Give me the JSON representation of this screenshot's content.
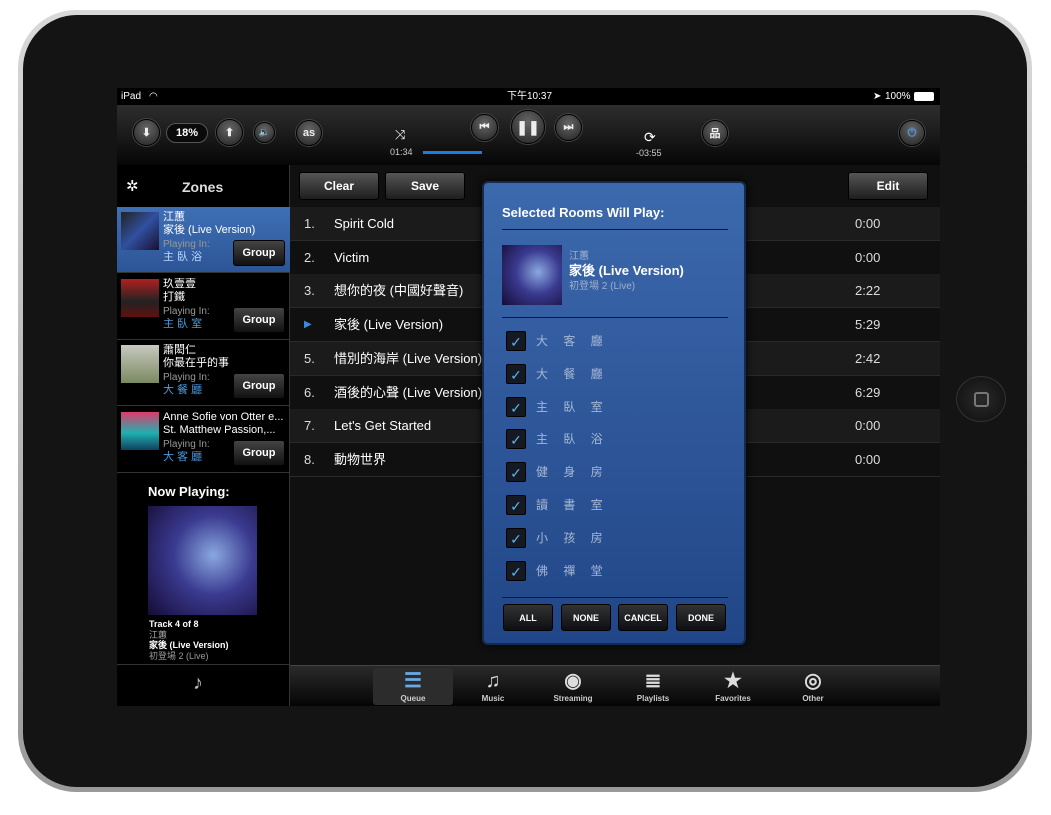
{
  "status_bar": {
    "device": "iPad",
    "time": "下午10:37",
    "battery": "100%"
  },
  "toolbar": {
    "volume": "18%",
    "elapsed": "01:34",
    "remaining": "-03:55",
    "progress_percent": 28,
    "lastfm_label": "as"
  },
  "sidebar": {
    "title": "Zones",
    "zones": [
      {
        "artist": "江蕙",
        "track": "家後 (Live Version)",
        "playing_in_label": "Playing In:",
        "room": "主 臥 浴",
        "group_label": "Group",
        "selected": true
      },
      {
        "artist": "玖壹壹",
        "track": "打鐵",
        "playing_in_label": "Playing In:",
        "room": "主 臥 室",
        "group_label": "Group"
      },
      {
        "artist": "蕭閎仁",
        "track": "你最在乎的事",
        "playing_in_label": "Playing In:",
        "room": "大 餐 廳",
        "group_label": "Group"
      },
      {
        "artist": "Anne Sofie von Otter e...",
        "track": "St. Matthew Passion,...",
        "playing_in_label": "Playing In:",
        "room": "大 客 廳",
        "group_label": "Group"
      }
    ],
    "now_playing": {
      "label": "Now Playing:",
      "track_info": "Track 4 of 8",
      "artist": "江蕙",
      "track": "家後 (Live Version)",
      "album": "初登場 2 (Live)"
    }
  },
  "queue": {
    "clear_label": "Clear",
    "save_label": "Save",
    "edit_label": "Edit",
    "tracks": [
      {
        "num": "1.",
        "title": "Spirit Cold",
        "duration": "0:00"
      },
      {
        "num": "2.",
        "title": "Victim",
        "duration": "0:00"
      },
      {
        "num": "3.",
        "title": "想你的夜 (中國好聲音)",
        "duration": "2:22"
      },
      {
        "num": "▶",
        "title": "家後 (Live Version)",
        "duration": "5:29",
        "playing": true
      },
      {
        "num": "5.",
        "title": "惜別的海岸 (Live Version)",
        "duration": "2:42"
      },
      {
        "num": "6.",
        "title": "酒後的心聲 (Live Version)",
        "duration": "6:29"
      },
      {
        "num": "7.",
        "title": "Let's Get Started",
        "duration": "0:00"
      },
      {
        "num": "8.",
        "title": "動物世界",
        "duration": "0:00"
      }
    ]
  },
  "popup": {
    "title": "Selected Rooms Will Play:",
    "artist": "江蕙",
    "track": "家後 (Live Version)",
    "album": "初登場 2 (Live)",
    "rooms": [
      {
        "name": "大 客 廳",
        "checked": true
      },
      {
        "name": "大 餐 廳",
        "checked": true
      },
      {
        "name": "主 臥 室",
        "checked": true
      },
      {
        "name": "主 臥 浴",
        "checked": true
      },
      {
        "name": "健 身 房",
        "checked": true
      },
      {
        "name": "讀 書 室",
        "checked": true
      },
      {
        "name": "小 孩 房",
        "checked": true
      },
      {
        "name": "佛 禪 堂",
        "checked": true
      }
    ],
    "all_label": "ALL",
    "none_label": "NONE",
    "cancel_label": "CANCEL",
    "done_label": "DONE"
  },
  "tabs": [
    {
      "label": "Queue",
      "icon": "list-icon",
      "active": true
    },
    {
      "label": "Music",
      "icon": "music-note-icon"
    },
    {
      "label": "Streaming",
      "icon": "streaming-icon"
    },
    {
      "label": "Playlists",
      "icon": "playlist-icon"
    },
    {
      "label": "Favorites",
      "icon": "star-icon"
    },
    {
      "label": "Other",
      "icon": "disc-icon"
    }
  ],
  "colors": {
    "accent": "#3a6ab0",
    "progress": "#1a7ee0",
    "room_text": "#4a9ae0"
  }
}
